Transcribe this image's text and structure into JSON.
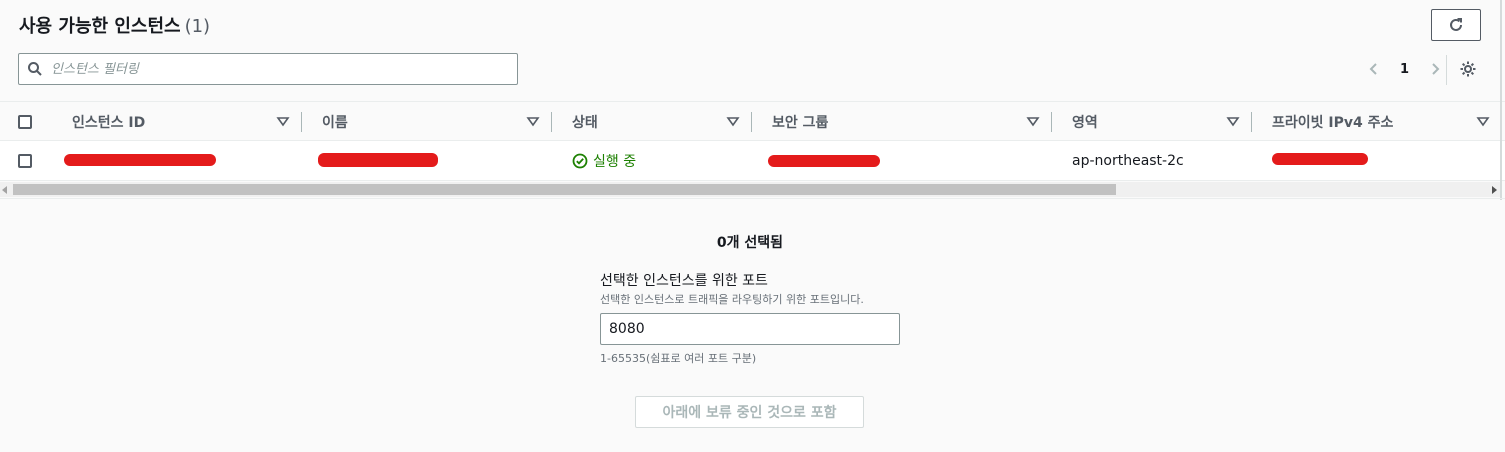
{
  "header": {
    "title": "사용 가능한 인스턴스",
    "count": "(1)"
  },
  "search": {
    "placeholder": "인스턴스 필터링",
    "value": ""
  },
  "pagination": {
    "current_page": "1"
  },
  "table": {
    "columns": [
      {
        "label": "인스턴스 ID"
      },
      {
        "label": "이름"
      },
      {
        "label": "상태"
      },
      {
        "label": "보안 그룹"
      },
      {
        "label": "영역"
      },
      {
        "label": "프라이빗 IPv4 주소"
      }
    ],
    "rows": [
      {
        "status": "실행 중",
        "zone": "ap-northeast-2c"
      }
    ]
  },
  "selection": {
    "summary": "0개 선택됨"
  },
  "port_form": {
    "label": "선택한 인스턴스를 위한 포트",
    "description": "선택한 인스턴스로 트래픽을 라우팅하기 위한 포트입니다.",
    "value": "8080",
    "hint": "1-65535(쉼표로 여러 포트 구분)"
  },
  "buttons": {
    "include_pending": "아래에 보류 중인 것으로 포함"
  },
  "colors": {
    "status_running": "#1d8102",
    "redaction": "#e41b1b"
  },
  "icons": {
    "refresh": "refresh-icon",
    "search": "search-icon",
    "prev": "chevron-left-icon",
    "next": "chevron-right-icon",
    "settings": "gear-icon",
    "sort": "caret-down-icon",
    "status": "check-circle-icon"
  }
}
